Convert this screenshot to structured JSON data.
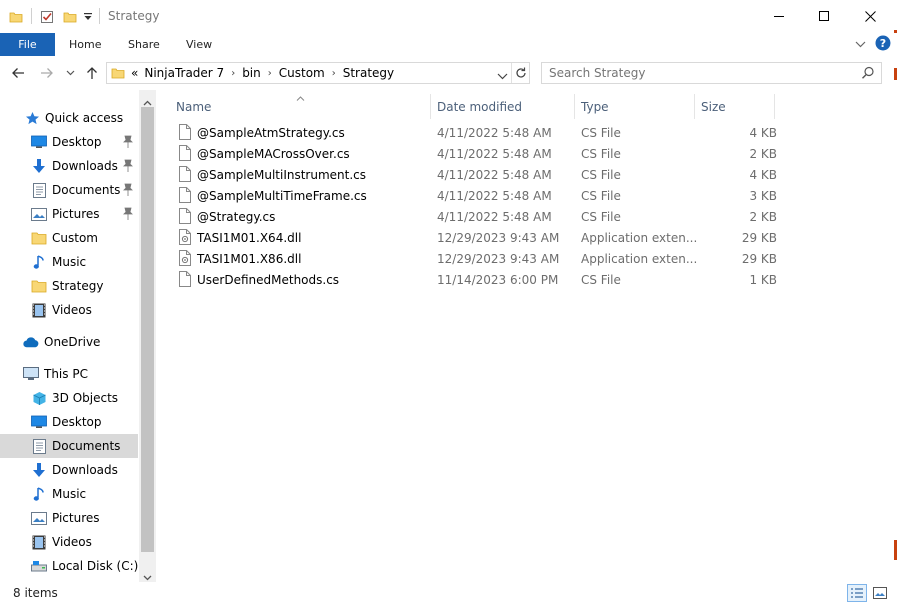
{
  "window": {
    "title": "Strategy"
  },
  "ribbon": {
    "tabs": [
      "File",
      "Home",
      "Share",
      "View"
    ]
  },
  "address": {
    "overflow": "«",
    "crumbs": [
      "NinjaTrader 7",
      "bin",
      "Custom",
      "Strategy"
    ]
  },
  "search": {
    "placeholder": "Search Strategy"
  },
  "nav": {
    "quick_access": "Quick access",
    "quick_items": [
      "Desktop",
      "Downloads",
      "Documents",
      "Pictures",
      "Custom",
      "Music",
      "Strategy",
      "Videos"
    ],
    "onedrive": "OneDrive",
    "this_pc": "This PC",
    "pc_items": [
      "3D Objects",
      "Desktop",
      "Documents",
      "Downloads",
      "Music",
      "Pictures",
      "Videos",
      "Local Disk (C:)"
    ]
  },
  "columns": {
    "name": "Name",
    "date": "Date modified",
    "type": "Type",
    "size": "Size"
  },
  "files": [
    {
      "name": "@SampleAtmStrategy.cs",
      "date": "4/11/2022 5:48 AM",
      "type": "CS File",
      "size": "4 KB"
    },
    {
      "name": "@SampleMACrossOver.cs",
      "date": "4/11/2022 5:48 AM",
      "type": "CS File",
      "size": "2 KB"
    },
    {
      "name": "@SampleMultiInstrument.cs",
      "date": "4/11/2022 5:48 AM",
      "type": "CS File",
      "size": "4 KB"
    },
    {
      "name": "@SampleMultiTimeFrame.cs",
      "date": "4/11/2022 5:48 AM",
      "type": "CS File",
      "size": "3 KB"
    },
    {
      "name": "@Strategy.cs",
      "date": "4/11/2022 5:48 AM",
      "type": "CS File",
      "size": "2 KB"
    },
    {
      "name": "TASI1M01.X64.dll",
      "date": "12/29/2023 9:43 AM",
      "type": "Application exten...",
      "size": "29 KB"
    },
    {
      "name": "TASI1M01.X86.dll",
      "date": "12/29/2023 9:43 AM",
      "type": "Application exten...",
      "size": "29 KB"
    },
    {
      "name": "UserDefinedMethods.cs",
      "date": "11/14/2023 6:00 PM",
      "type": "CS File",
      "size": "1 KB"
    }
  ],
  "status": {
    "count": "8 items"
  },
  "colors": {
    "file_tab": "#1a63b5",
    "selection": "#d9d9d9",
    "header_text": "#4c607a",
    "folder": "#f8d775",
    "accent_edge": "#c8410f"
  }
}
